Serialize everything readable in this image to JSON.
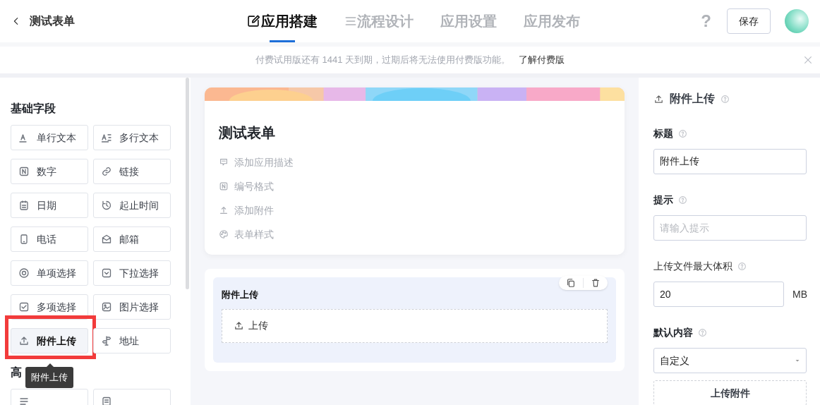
{
  "header": {
    "back_title": "测试表单",
    "tabs": [
      {
        "label": "应用搭建",
        "selected": true
      },
      {
        "label": "流程设计",
        "selected": false
      },
      {
        "label": "应用设置",
        "selected": false
      },
      {
        "label": "应用发布",
        "selected": false
      }
    ],
    "help": "?",
    "save_button": "保存"
  },
  "banner": {
    "message": "付费试用版还有 1441 天到期，过期后将无法使用付费版功能。",
    "link": "了解付费版"
  },
  "sidebar": {
    "sections": [
      {
        "title": "基础字段",
        "items": [
          {
            "label": "单行文本",
            "selected": false
          },
          {
            "label": "多行文本",
            "selected": false
          },
          {
            "label": "数字",
            "selected": false
          },
          {
            "label": "链接",
            "selected": false
          },
          {
            "label": "日期",
            "selected": false
          },
          {
            "label": "起止时间",
            "selected": false
          },
          {
            "label": "电话",
            "selected": false
          },
          {
            "label": "邮箱",
            "selected": false
          },
          {
            "label": "单项选择",
            "selected": false
          },
          {
            "label": "下拉选择",
            "selected": false
          },
          {
            "label": "多项选择",
            "selected": false
          },
          {
            "label": "图片选择",
            "selected": false
          },
          {
            "label": "附件上传",
            "selected": true
          },
          {
            "label": "地址",
            "selected": false
          }
        ]
      },
      {
        "title": "高",
        "items": [
          {
            "selected": false
          },
          {
            "selected": false
          }
        ]
      }
    ],
    "tooltip": "附件上传"
  },
  "form": {
    "title": "测试表单",
    "actions": [
      "添加应用描述",
      "编号格式",
      "添加附件",
      "表单样式"
    ],
    "fields": [
      {
        "label": "附件上传",
        "upload_label": "上传"
      }
    ]
  },
  "properties": {
    "title": "附件上传",
    "groups": [
      {
        "kind": "text",
        "label": "标题",
        "value": "附件上传"
      },
      {
        "kind": "text",
        "label": "提示",
        "placeholder": "请输入提示"
      },
      {
        "kind": "unit",
        "label": "上传文件最大体积",
        "value": "20",
        "unit": "MB"
      },
      {
        "kind": "select",
        "label": "默认内容",
        "value": "自定义",
        "button": "上传附件"
      }
    ]
  }
}
